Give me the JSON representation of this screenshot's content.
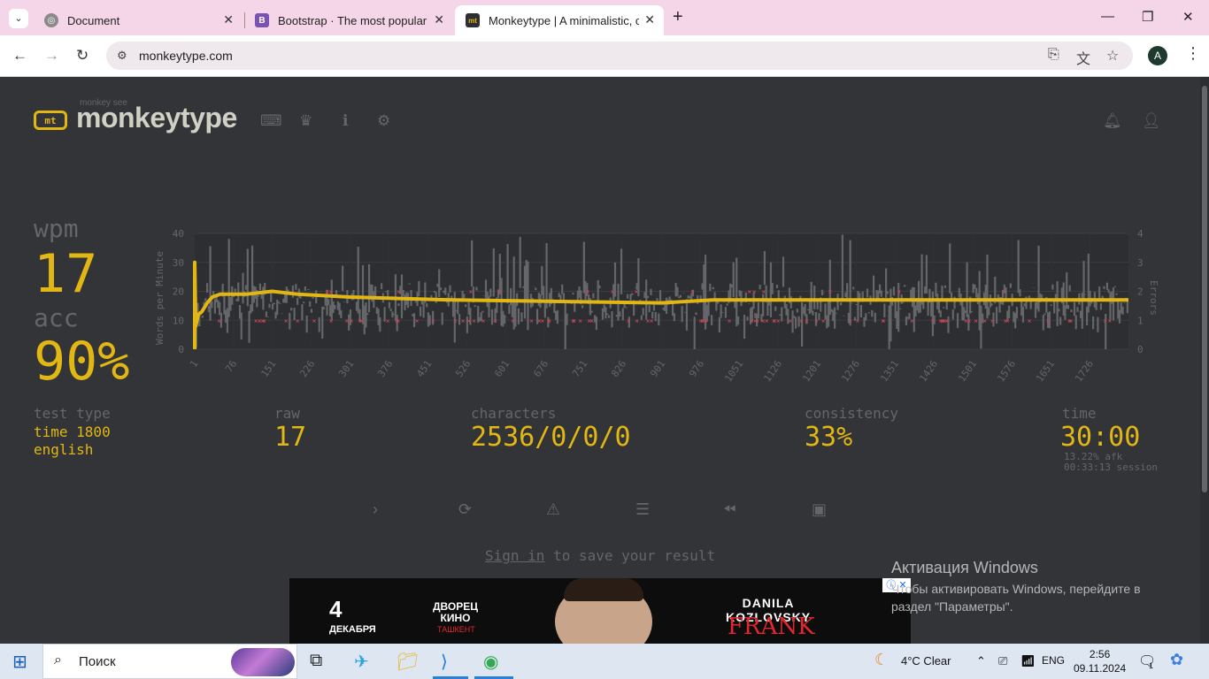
{
  "browser": {
    "tabs": [
      {
        "title": "Document",
        "active": false
      },
      {
        "title": "Bootstrap · The most popular H",
        "active": false
      },
      {
        "title": "Monkeytype | A minimalistic, cu",
        "active": true
      }
    ],
    "new_tab": "+",
    "url": "monkeytype.com",
    "profile_initial": "A"
  },
  "app": {
    "logo_mark": "mt",
    "logo_sub": "monkey see",
    "logo_text": "monkeytype"
  },
  "result": {
    "wpm_label": "wpm",
    "wpm": "17",
    "acc_label": "acc",
    "acc": "90%",
    "test_type_label": "test type",
    "test_type_1": "time 1800",
    "test_type_2": "english",
    "raw_label": "raw",
    "raw": "17",
    "characters_label": "characters",
    "characters": "2536/0/0/0",
    "consistency_label": "consistency",
    "consistency": "33%",
    "time_label": "time",
    "time": "30:00",
    "afk": "13.22% afk",
    "session": "00:33:13 session"
  },
  "chart_data": {
    "type": "line",
    "ylabel": "Words per Minute",
    "y2label": "Errors",
    "ylim": [
      0,
      40
    ],
    "y2lim": [
      0,
      4
    ],
    "yticks": [
      "0",
      "10",
      "20",
      "30",
      "40"
    ],
    "y2ticks": [
      "0",
      "1",
      "2",
      "3",
      "4"
    ],
    "xticks": [
      "1",
      "76",
      "151",
      "226",
      "301",
      "376",
      "451",
      "526",
      "601",
      "676",
      "751",
      "826",
      "901",
      "976",
      "1051",
      "1126",
      "1201",
      "1276",
      "1351",
      "1426",
      "1501",
      "1576",
      "1651",
      "1726"
    ],
    "x_max": 1800,
    "series": [
      {
        "role": "raw",
        "color": "#646669"
      },
      {
        "role": "wpm",
        "color": "#e2b714",
        "points": [
          [
            1,
            0
          ],
          [
            1,
            30
          ],
          [
            3,
            8
          ],
          [
            8,
            12
          ],
          [
            15,
            13
          ],
          [
            25,
            16
          ],
          [
            35,
            18
          ],
          [
            50,
            19
          ],
          [
            100,
            19
          ],
          [
            150,
            20
          ],
          [
            200,
            19
          ],
          [
            300,
            18
          ],
          [
            500,
            17
          ],
          [
            900,
            16
          ],
          [
            1000,
            17
          ],
          [
            1800,
            17
          ]
        ]
      },
      {
        "role": "errors",
        "color": "#ca4754"
      }
    ]
  },
  "actions": {
    "next": "next test",
    "restart": "repeat test",
    "report": "practice words",
    "history": "toggle words history",
    "replay": "watch replay",
    "screenshot": "save screenshot"
  },
  "signin": {
    "link": "Sign in",
    "rest": "to save your result"
  },
  "ad": {
    "day": "4",
    "month": "ДЕКАБРЯ",
    "venue": "ДВОРЕЦ\nКИНО",
    "city": "ТАШКЕНТ",
    "name": "DANILA\nKOZLOVSKY",
    "show": "FRANK"
  },
  "windows": {
    "activate_title": "Активация Windows",
    "activate_text": "Чтобы активировать Windows, перейдите в раздел \"Параметры\"."
  },
  "taskbar": {
    "search": "Поиск",
    "weather": "4°C  Clear",
    "lang": "ENG",
    "time": "2:56",
    "date": "09.11.2024",
    "notif_count": "1"
  }
}
